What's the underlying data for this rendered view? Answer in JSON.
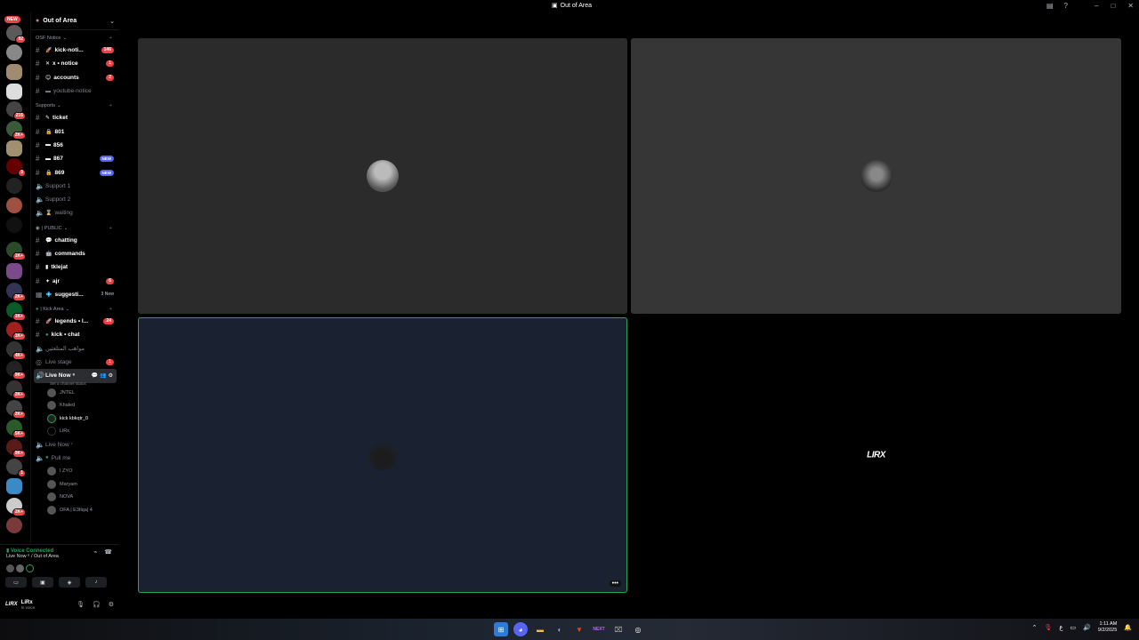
{
  "window": {
    "title": "Out of Area"
  },
  "rail": {
    "new_label": "NEW",
    "badges": [
      "92",
      "216",
      "2K+",
      "9",
      "1K+",
      "2K+",
      "1K+",
      "1K+",
      "4K+",
      "9K+",
      "2K+",
      "2K+",
      "5K+",
      "9K+",
      "1",
      "2K+"
    ]
  },
  "guild": {
    "name": "Out of Area"
  },
  "categories": {
    "notice": "OSF Notice",
    "supports": "Supports",
    "public": "| PUBLIC",
    "kick": "| Kick Area"
  },
  "channels": {
    "kick_notice": {
      "name": "kick-noti...",
      "count": "146"
    },
    "x_notice": {
      "name": "x • notice",
      "count": "1"
    },
    "accounts": {
      "name": "accounts",
      "count": "2"
    },
    "youtube": {
      "name": "youtube-notice"
    },
    "ticket": {
      "name": "ticket"
    },
    "t801": {
      "name": "801"
    },
    "t856": {
      "name": "856"
    },
    "t867": {
      "name": "867",
      "tag": "NEW"
    },
    "t869": {
      "name": "869",
      "tag": "NEW"
    },
    "support1": {
      "name": "Support 1"
    },
    "support2": {
      "name": "Support 2"
    },
    "waiting": {
      "name": "waiting"
    },
    "chatting": {
      "name": "chatting"
    },
    "commands": {
      "name": "commands"
    },
    "tklejat": {
      "name": "tklejat"
    },
    "ajr": {
      "name": "ajr",
      "count": "6"
    },
    "suggest": {
      "name": "suggesti...",
      "newtxt": "3 New"
    },
    "legends": {
      "name": "legends • l...",
      "count": "24"
    },
    "kickchat": {
      "name": "kick • chat"
    },
    "arabic": {
      "name": "مواهب المتلعثين"
    },
    "livestage": {
      "name": "Live stage",
      "count": "1"
    },
    "livenow": {
      "name": "Live Now ⁶",
      "status": "Set a channel status"
    },
    "livenow2": {
      "name": "Live Now ⁷"
    },
    "pullme": {
      "name": "Pull me"
    }
  },
  "voice_users": [
    "JNTEL",
    "Khaled",
    "kick kbkqtr_0",
    "LiRx"
  ],
  "pull_users": [
    "I ZYO",
    "Maryam",
    "NOVA",
    "OFA | E3tlqa| 4"
  ],
  "voice_panel": {
    "status": "Voice Connected",
    "sub": "Live Now ⁶ / Out of Area"
  },
  "user_panel": {
    "name": "LiRx",
    "sub": "In voice"
  },
  "stage": {
    "logo_text": "LIRX",
    "more": "•••"
  },
  "taskbar": {
    "time": "1:11 AM",
    "date": "9/2/2025",
    "lang": "ع"
  }
}
